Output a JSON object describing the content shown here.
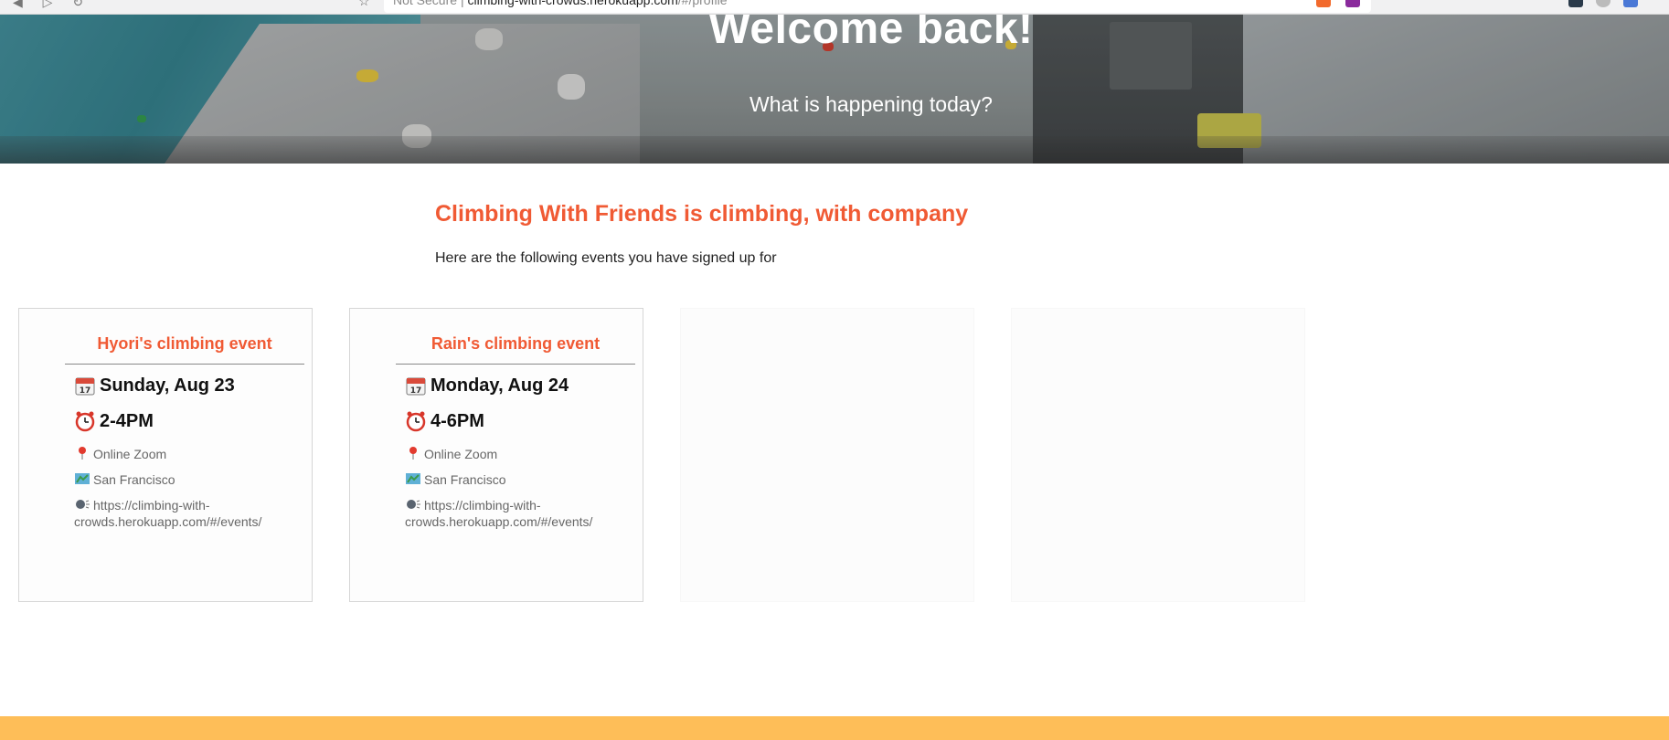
{
  "browser": {
    "security_label": "Not Secure",
    "url_host": "climbing-with-crowds.herokuapp.com",
    "url_path": "/#/profile"
  },
  "hero": {
    "title": "Welcome back!",
    "subtitle": "What is happening today?"
  },
  "intro": {
    "title": "Climbing With Friends is climbing, with company",
    "text": "Here are the following events you have signed up for"
  },
  "events": [
    {
      "title": "Hyori's climbing event",
      "date": "Sunday, Aug 23",
      "time": "2-4PM",
      "location": "Online Zoom",
      "city": "San Francisco",
      "link": "https://climbing-with-crowds.herokuapp.com/#/events/"
    },
    {
      "title": "Rain's climbing event",
      "date": "Monday, Aug 24",
      "time": "4-6PM",
      "location": "Online Zoom",
      "city": "San Francisco",
      "link": "https://climbing-with-crowds.herokuapp.com/#/events/"
    }
  ],
  "icons": {
    "date": "calendar-icon",
    "time": "alarm-clock-icon",
    "location": "pin-icon",
    "city": "map-icon",
    "link": "speaking-head-icon"
  },
  "colors": {
    "accent": "#f05a34",
    "footer": "#febe58"
  }
}
